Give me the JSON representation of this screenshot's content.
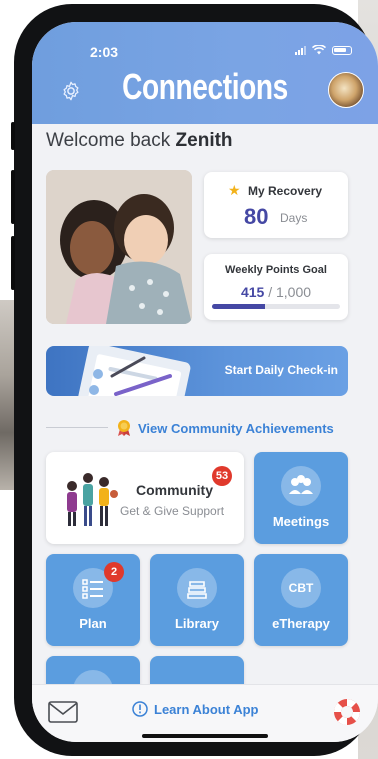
{
  "status_bar": {
    "time": "2:03"
  },
  "header": {
    "title": "Connections"
  },
  "welcome": {
    "prefix": "Welcome back",
    "name": "Zenith"
  },
  "recovery": {
    "label": "My Recovery",
    "value": "80",
    "unit": "Days"
  },
  "points": {
    "label": "Weekly Points Goal",
    "current": "415",
    "separator": " / ",
    "goal": "1,000",
    "progress_fraction": 0.415
  },
  "checkin": {
    "label": "Start Daily Check-in"
  },
  "achievements": {
    "label": "View Community Achievements"
  },
  "community": {
    "title": "Community",
    "subtitle": "Get & Give Support",
    "badge": "53"
  },
  "tiles": {
    "meetings": "Meetings",
    "plan": "Plan",
    "plan_badge": "2",
    "library": "Library",
    "etherapy": "eTherapy",
    "etherapy_icon_text": "CBT"
  },
  "footer": {
    "learn": "Learn About App"
  },
  "colors": {
    "accent": "#3b82d6",
    "tile": "#5b9ddf",
    "header": "#7aa4e4",
    "badge": "#e0392c",
    "stat": "#4548a4"
  }
}
